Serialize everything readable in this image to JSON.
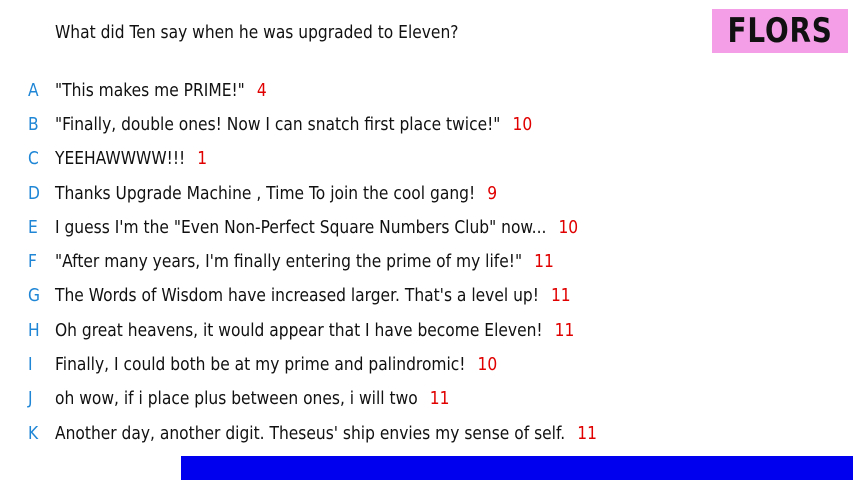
{
  "question": "What did Ten say when he was upgraded to Eleven?",
  "title": "FLORS",
  "colors": {
    "title_bg": "#f39ee6",
    "letter": "#1f86d6",
    "score": "#e00000",
    "bar": "#0000ee"
  },
  "answers": [
    {
      "letter": "A",
      "text": "\"This makes me PRIME!\"",
      "score": "4"
    },
    {
      "letter": "B",
      "text": "\"Finally, double ones! Now I can snatch first place twice!\"",
      "score": "10"
    },
    {
      "letter": "C",
      "text": "YEEHAWWWW!!!",
      "score": "1"
    },
    {
      "letter": "D",
      "text": "Thanks Upgrade Machine , Time To join the cool gang!",
      "score": "9"
    },
    {
      "letter": "E",
      "text": "I guess I'm the \"Even Non-Perfect Square Numbers Club\" now...",
      "score": "10"
    },
    {
      "letter": "F",
      "text": "\"After many years, I'm finally entering the prime of my life!\"",
      "score": "11"
    },
    {
      "letter": "G",
      "text": "The Words of Wisdom have increased larger. That's a level up!",
      "score": "11"
    },
    {
      "letter": "H",
      "text": "Oh great heavens, it would appear that I have become Eleven!",
      "score": "11"
    },
    {
      "letter": "I",
      "text": "Finally, I could both be at my prime and palindromic!",
      "score": "10"
    },
    {
      "letter": "J",
      "text": "oh wow, if i place plus between ones, i will two",
      "score": "11"
    },
    {
      "letter": "K",
      "text": "Another day, another digit. Theseus' ship envies my sense of self.",
      "score": "11"
    }
  ]
}
